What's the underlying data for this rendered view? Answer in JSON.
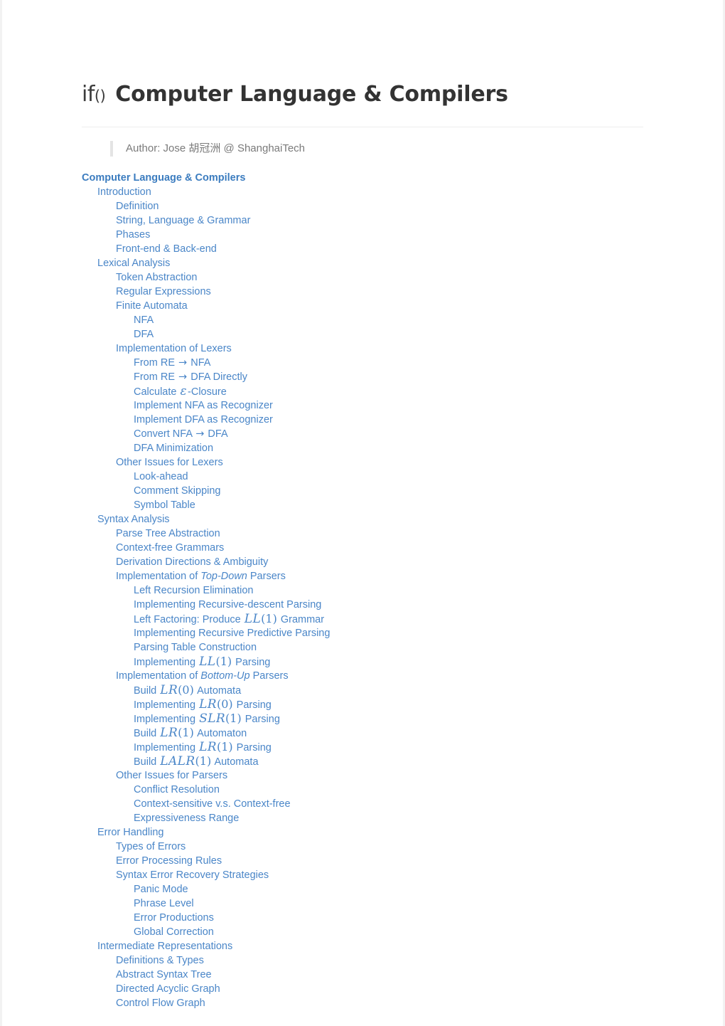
{
  "document": {
    "logo_text": "if",
    "logo_paren": "()",
    "title": "Computer Language & Compilers",
    "author_line": "Author: Jose 胡冠洲 @ ShanghaiTech",
    "link_color": "#4a86c8",
    "heading_link_color": "#3b7cbf",
    "title_color": "#333333",
    "author_color": "#7a7a7a"
  },
  "toc": [
    {
      "level": 0,
      "label": "Computer Language & Compilers"
    },
    {
      "level": 1,
      "label": "Introduction"
    },
    {
      "level": 2,
      "label": "Definition"
    },
    {
      "level": 2,
      "label": "String, Language & Grammar"
    },
    {
      "level": 2,
      "label": "Phases"
    },
    {
      "level": 2,
      "label": "Front-end & Back-end"
    },
    {
      "level": 1,
      "label": "Lexical Analysis"
    },
    {
      "level": 2,
      "label": "Token Abstraction"
    },
    {
      "level": 2,
      "label": "Regular Expressions"
    },
    {
      "level": 2,
      "label": "Finite Automata"
    },
    {
      "level": 3,
      "label": "NFA"
    },
    {
      "level": 3,
      "label": "DFA"
    },
    {
      "level": 2,
      "label": "Implementation of Lexers"
    },
    {
      "level": 3,
      "label": "From RE → NFA"
    },
    {
      "level": 3,
      "label": "From RE → DFA Directly"
    },
    {
      "level": 3,
      "label": "Calculate ε-Closure"
    },
    {
      "level": 3,
      "label": "Implement NFA as Recognizer"
    },
    {
      "level": 3,
      "label": "Implement DFA as Recognizer"
    },
    {
      "level": 3,
      "label": "Convert NFA → DFA"
    },
    {
      "level": 3,
      "label": "DFA Minimization"
    },
    {
      "level": 2,
      "label": "Other Issues for Lexers"
    },
    {
      "level": 3,
      "label": "Look-ahead"
    },
    {
      "level": 3,
      "label": "Comment Skipping"
    },
    {
      "level": 3,
      "label": "Symbol Table"
    },
    {
      "level": 1,
      "label": "Syntax Analysis"
    },
    {
      "level": 2,
      "label": "Parse Tree Abstraction"
    },
    {
      "level": 2,
      "label": "Context-free Grammars"
    },
    {
      "level": 2,
      "label": "Derivation Directions & Ambiguity"
    },
    {
      "level": 2,
      "label": "Implementation of Top-Down Parsers"
    },
    {
      "level": 3,
      "label": "Left Recursion Elimination"
    },
    {
      "level": 3,
      "label": "Implementing Recursive-descent Parsing"
    },
    {
      "level": 3,
      "label": "Left Factoring: Produce LL(1) Grammar"
    },
    {
      "level": 3,
      "label": "Implementing Recursive Predictive Parsing"
    },
    {
      "level": 3,
      "label": "Parsing Table Construction"
    },
    {
      "level": 3,
      "label": "Implementing LL(1) Parsing"
    },
    {
      "level": 2,
      "label": "Implementation of Bottom-Up Parsers"
    },
    {
      "level": 3,
      "label": "Build LR(0) Automata"
    },
    {
      "level": 3,
      "label": "Implementing LR(0) Parsing"
    },
    {
      "level": 3,
      "label": "Implementing SLR(1) Parsing"
    },
    {
      "level": 3,
      "label": "Build LR(1) Automaton"
    },
    {
      "level": 3,
      "label": "Implementing LR(1) Parsing"
    },
    {
      "level": 3,
      "label": "Build LALR(1) Automata"
    },
    {
      "level": 2,
      "label": "Other Issues for Parsers"
    },
    {
      "level": 3,
      "label": "Conflict Resolution"
    },
    {
      "level": 3,
      "label": "Context-sensitive v.s. Context-free"
    },
    {
      "level": 3,
      "label": "Expressiveness Range"
    },
    {
      "level": 1,
      "label": "Error Handling"
    },
    {
      "level": 2,
      "label": "Types of Errors"
    },
    {
      "level": 2,
      "label": "Error Processing Rules"
    },
    {
      "level": 2,
      "label": "Syntax Error Recovery Strategies"
    },
    {
      "level": 3,
      "label": "Panic Mode"
    },
    {
      "level": 3,
      "label": "Phrase Level"
    },
    {
      "level": 3,
      "label": "Error Productions"
    },
    {
      "level": 3,
      "label": "Global Correction"
    },
    {
      "level": 1,
      "label": "Intermediate Representations"
    },
    {
      "level": 2,
      "label": "Definitions & Types"
    },
    {
      "level": 2,
      "label": "Abstract Syntax Tree"
    },
    {
      "level": 2,
      "label": "Directed Acyclic Graph"
    },
    {
      "level": 2,
      "label": "Control Flow Graph"
    }
  ]
}
